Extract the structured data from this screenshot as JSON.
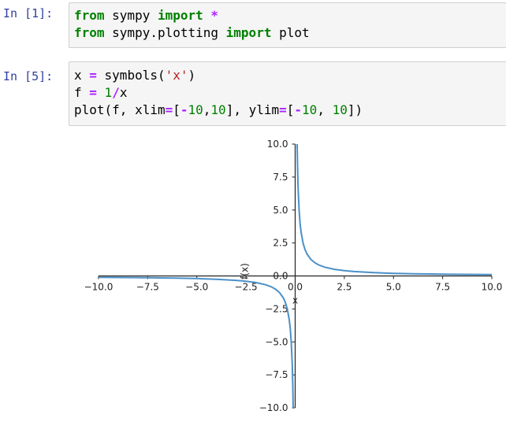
{
  "cells": [
    {
      "prompt": "In [1]:",
      "lines": [
        [
          [
            "kw",
            "from"
          ],
          [
            "plain",
            " sympy "
          ],
          [
            "kw",
            "import"
          ],
          [
            "plain",
            " "
          ],
          [
            "op",
            "*"
          ]
        ],
        [
          [
            "kw",
            "from"
          ],
          [
            "plain",
            " sympy.plotting "
          ],
          [
            "kw",
            "import"
          ],
          [
            "plain",
            " plot"
          ]
        ]
      ]
    },
    {
      "prompt": "In [5]:",
      "lines": [
        [
          [
            "plain",
            "x "
          ],
          [
            "op",
            "="
          ],
          [
            "plain",
            " symbols("
          ],
          [
            "str",
            "'x'"
          ],
          [
            "plain",
            ")"
          ]
        ],
        [
          [
            "plain",
            "f "
          ],
          [
            "op",
            "="
          ],
          [
            "plain",
            " "
          ],
          [
            "num",
            "1"
          ],
          [
            "op",
            "/"
          ],
          [
            "plain",
            "x"
          ]
        ],
        [
          [
            "plain",
            "plot(f, xlim"
          ],
          [
            "op",
            "="
          ],
          [
            "plain",
            "["
          ],
          [
            "op",
            "-"
          ],
          [
            "num",
            "10"
          ],
          [
            "plain",
            ","
          ],
          [
            "num",
            "10"
          ],
          [
            "plain",
            "], ylim"
          ],
          [
            "op",
            "="
          ],
          [
            "plain",
            "["
          ],
          [
            "op",
            "-"
          ],
          [
            "num",
            "10"
          ],
          [
            "plain",
            ", "
          ],
          [
            "num",
            "10"
          ],
          [
            "plain",
            "])"
          ]
        ]
      ]
    }
  ],
  "chart_data": {
    "type": "line",
    "title": "",
    "xlabel": "x",
    "ylabel": "f(x)",
    "xlim": [
      -10,
      10
    ],
    "ylim": [
      -10,
      10
    ],
    "function": "1/x",
    "x_ticks": [
      -10.0,
      -7.5,
      -5.0,
      -2.5,
      0.0,
      2.5,
      5.0,
      7.5,
      10.0
    ],
    "y_ticks": [
      -10.0,
      -7.5,
      -5.0,
      -2.5,
      0.0,
      2.5,
      5.0,
      7.5,
      10.0
    ],
    "x_tick_labels": [
      "−10.0",
      "−7.5",
      "−5.0",
      "−2.5",
      "0.0",
      "2.5",
      "5.0",
      "7.5",
      "10.0"
    ],
    "y_tick_labels": [
      "−10.0",
      "−7.5",
      "−5.0",
      "−2.5",
      "0.0",
      "2.5",
      "5.0",
      "7.5",
      "10.0"
    ],
    "series": [
      {
        "color": "#4a90c8",
        "segments": [
          {
            "x": [
              -10,
              -8,
              -6,
              -5,
              -4,
              -3,
              -2.5,
              -2,
              -1.5,
              -1.2,
              -1,
              -0.8,
              -0.6,
              -0.5,
              -0.4,
              -0.3,
              -0.25,
              -0.2,
              -0.15,
              -0.12,
              -0.1
            ],
            "y": [
              -0.1,
              -0.125,
              -0.1667,
              -0.2,
              -0.25,
              -0.3333,
              -0.4,
              -0.5,
              -0.6667,
              -0.8333,
              -1,
              -1.25,
              -1.6667,
              -2,
              -2.5,
              -3.3333,
              -4,
              -5,
              -6.6667,
              -8.3333,
              -10
            ]
          },
          {
            "x": [
              0.1,
              0.12,
              0.15,
              0.2,
              0.25,
              0.3,
              0.4,
              0.5,
              0.6,
              0.8,
              1,
              1.2,
              1.5,
              2,
              2.5,
              3,
              4,
              5,
              6,
              8,
              10
            ],
            "y": [
              10,
              8.3333,
              6.6667,
              5,
              4,
              3.3333,
              2.5,
              2,
              1.6667,
              1.25,
              1,
              0.8333,
              0.6667,
              0.5,
              0.4,
              0.3333,
              0.25,
              0.2,
              0.1667,
              0.125,
              0.1
            ]
          }
        ]
      }
    ]
  }
}
